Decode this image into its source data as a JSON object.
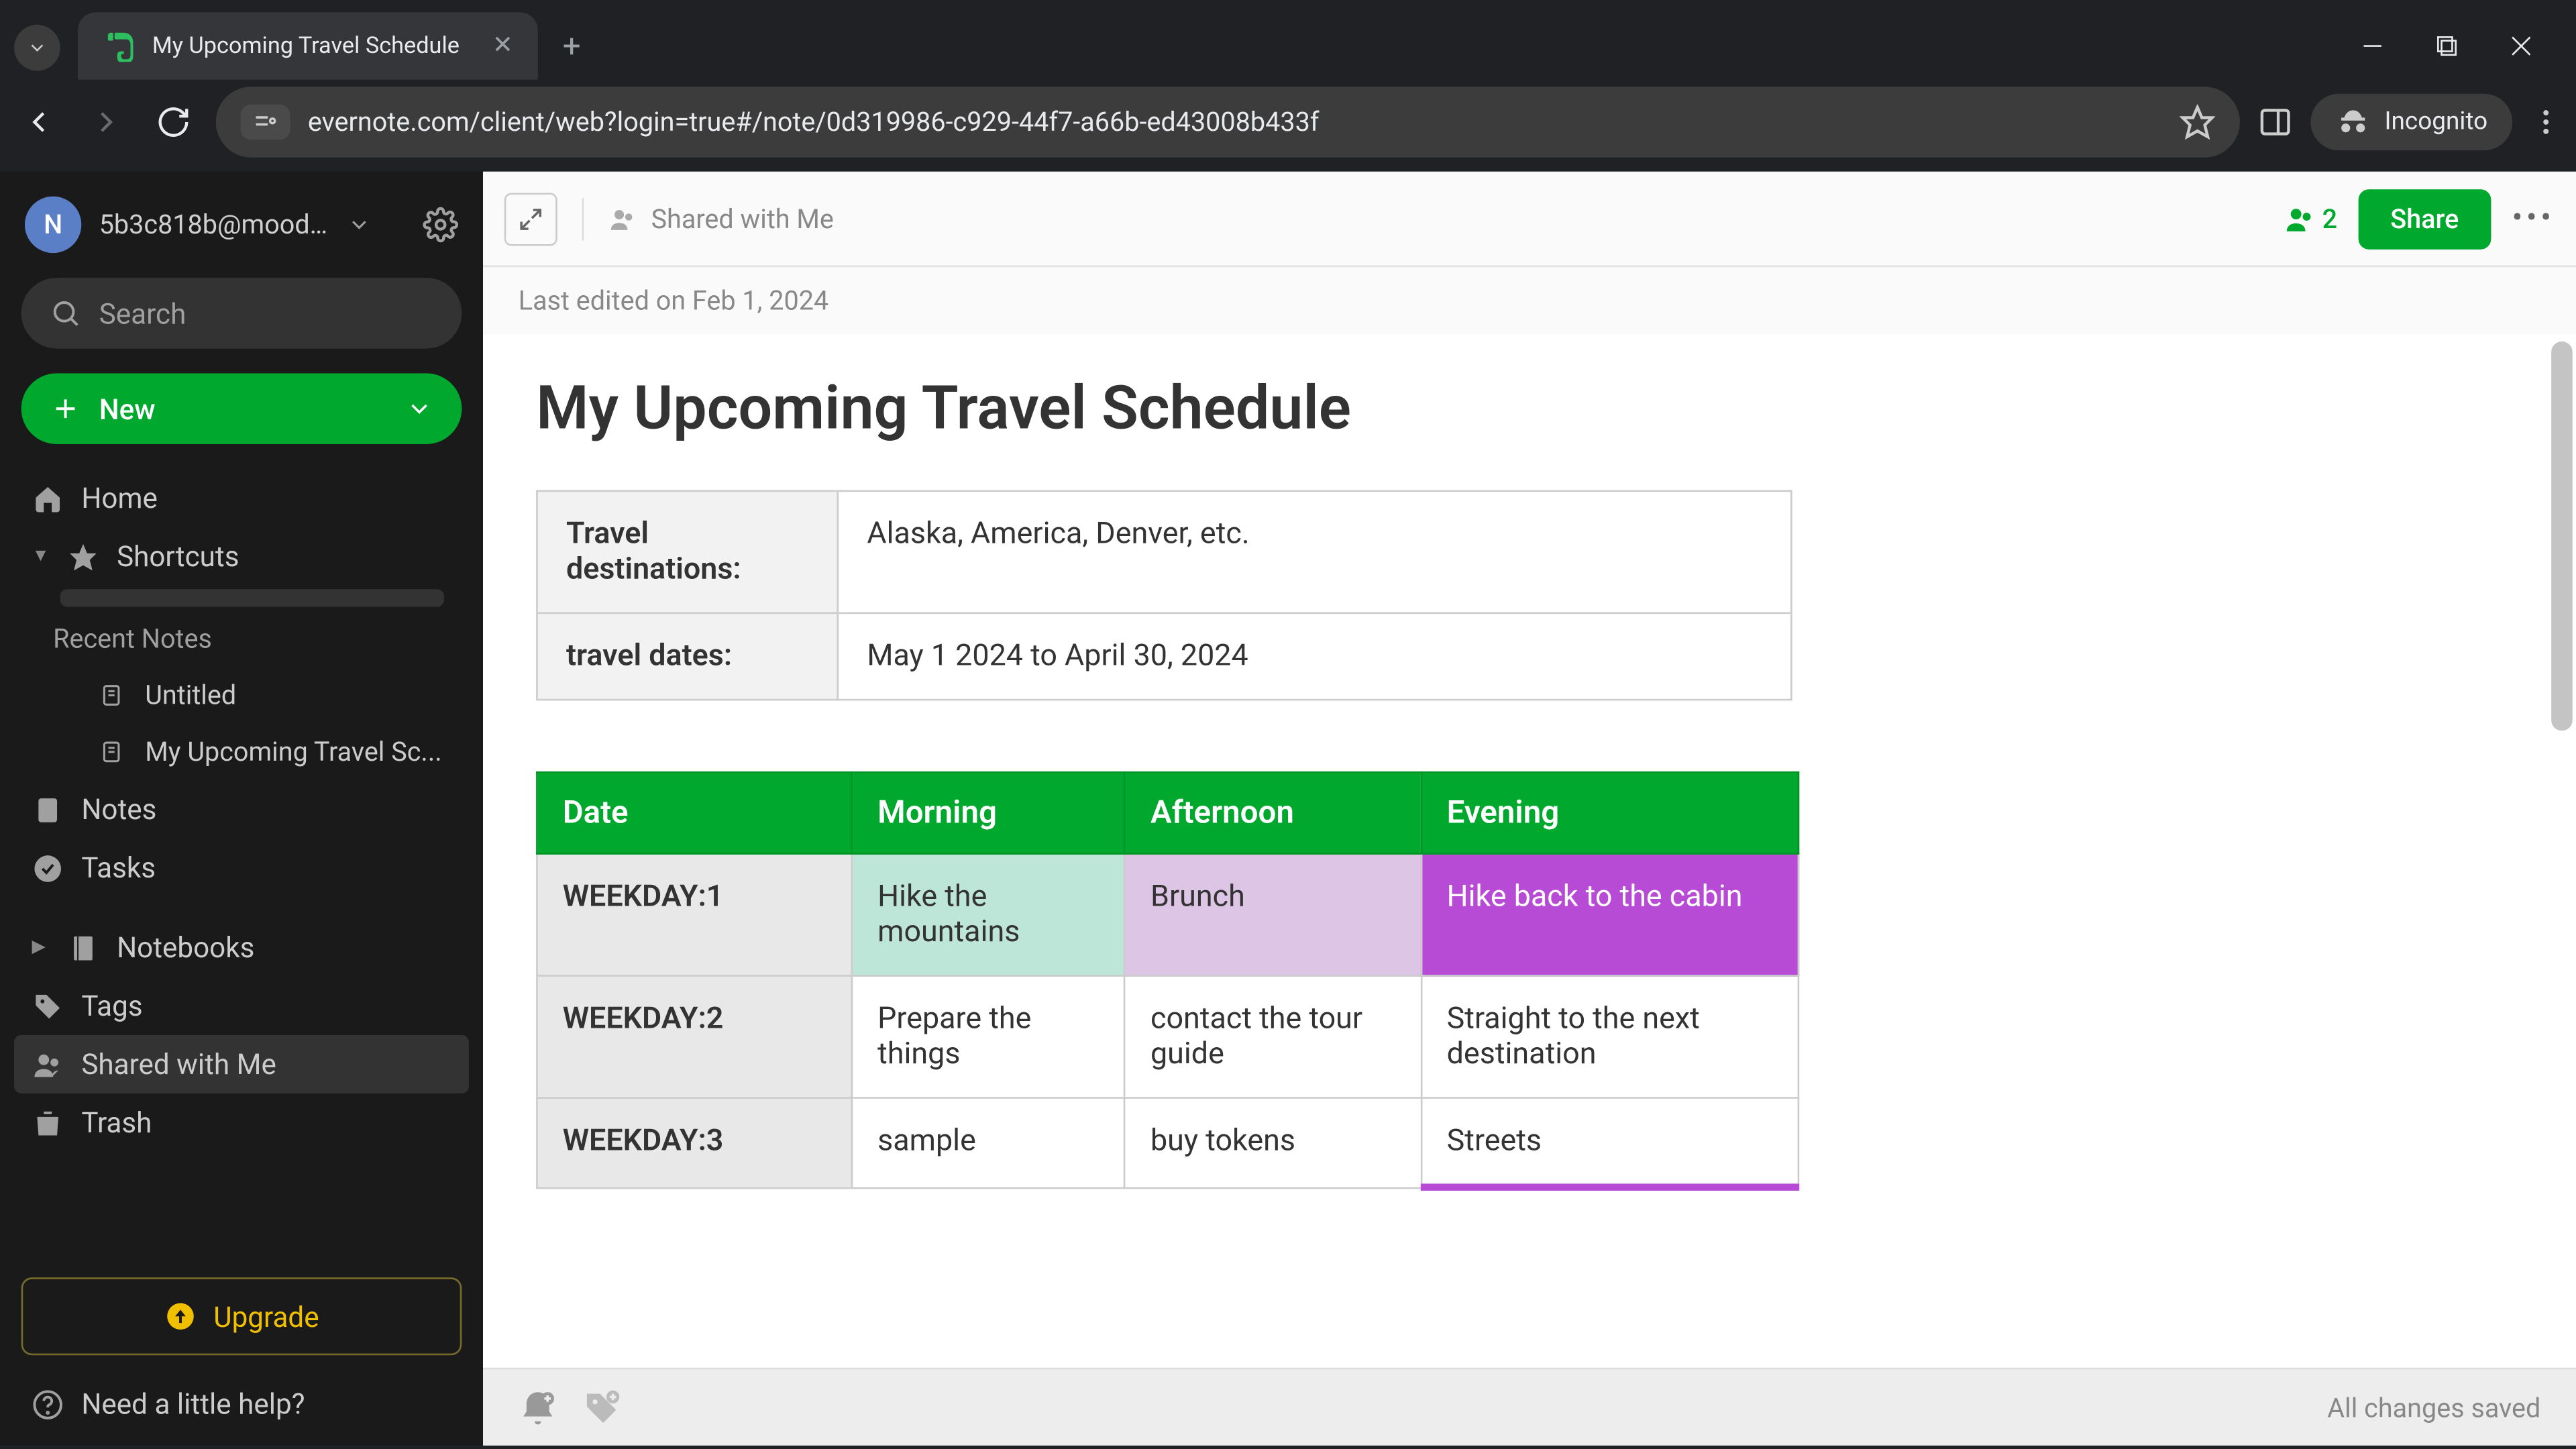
{
  "browser": {
    "tab_title": "My Upcoming Travel Schedule",
    "url": "evernote.com/client/web?login=true#/note/0d319986-c929-44f7-a66b-ed43008b433f",
    "incognito_label": "Incognito"
  },
  "sidebar": {
    "avatar_initial": "N",
    "user_name": "5b3c818b@mood...",
    "search_placeholder": "Search",
    "new_label": "New",
    "home": "Home",
    "shortcuts": "Shortcuts",
    "recent_notes_label": "Recent Notes",
    "recent": [
      {
        "label": "Untitled"
      },
      {
        "label": "My Upcoming Travel Sc..."
      }
    ],
    "notes": "Notes",
    "tasks": "Tasks",
    "notebooks": "Notebooks",
    "tags": "Tags",
    "shared": "Shared with Me",
    "trash": "Trash",
    "upgrade": "Upgrade",
    "help": "Need a little help?"
  },
  "topbar": {
    "shared_label": "Shared with Me",
    "share_count": "2",
    "share_btn": "Share",
    "last_edited": "Last edited on Feb 1, 2024"
  },
  "note": {
    "title": "My Upcoming Travel Schedule",
    "info_rows": [
      {
        "label": "Travel destinations:",
        "value": "Alaska, America, Denver, etc."
      },
      {
        "label": "travel dates:",
        "value": "May 1 2024 to April 30, 2024"
      }
    ],
    "sched_headers": [
      "Date",
      "Morning",
      "Afternoon",
      "Evening"
    ],
    "sched_rows": [
      {
        "day": "WEEKDAY:1",
        "morning": "Hike the mountains",
        "afternoon": "Brunch",
        "evening": "Hike back to the cabin"
      },
      {
        "day": "WEEKDAY:2",
        "morning": "Prepare the things",
        "afternoon": "contact the tour guide",
        "evening": "Straight to the next destination"
      },
      {
        "day": "WEEKDAY:3",
        "morning": "sample",
        "afternoon": "buy tokens",
        "evening": "Streets"
      }
    ]
  },
  "footer": {
    "status": "All changes saved"
  }
}
